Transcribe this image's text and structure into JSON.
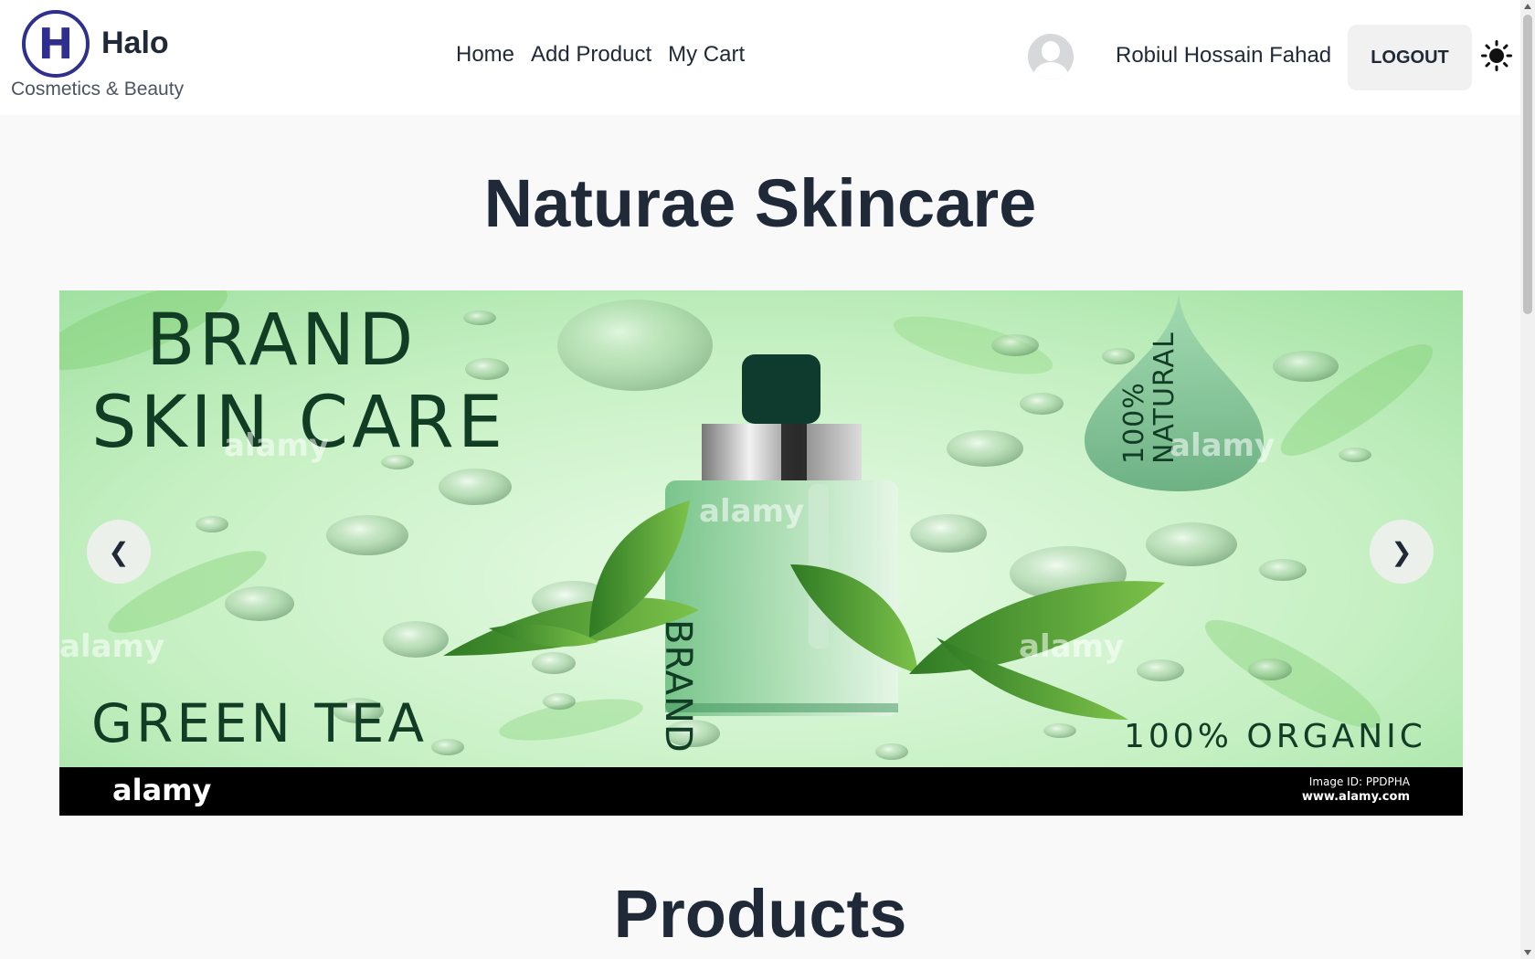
{
  "navbar": {
    "logo_letter": "H",
    "brand_name": "Halo",
    "brand_tagline": "Cosmetics & Beauty",
    "links": [
      {
        "label": "Home"
      },
      {
        "label": "Add Product"
      },
      {
        "label": "My Cart"
      }
    ],
    "user_name": "Robiul Hossain Fahad",
    "logout_label": "LOGOUT",
    "theme_icon": "sun-icon",
    "avatar_icon": "user-placeholder-icon"
  },
  "page": {
    "title": "Naturae Skincare",
    "section_title": "Products"
  },
  "carousel": {
    "prev_label": "❮",
    "next_label": "❯",
    "slide": {
      "line1": "BRAND",
      "line2": "SKIN CARE",
      "line3": "GREEN TEA",
      "badge": "100% ORGANIC",
      "drop_text_1": "100%",
      "drop_text_2": "NATURAL",
      "bottle_text": "BRAND",
      "watermark": "alamy",
      "footer_logo": "alamy",
      "footer_id": "Image ID: PPDPHA",
      "footer_url": "www.alamy.com"
    }
  },
  "colors": {
    "logo": "#2e2f8f",
    "text": "#1f2937",
    "background": "#f9f9fa",
    "slide_green": "#c9f0c8",
    "slide_text": "#123d25"
  }
}
